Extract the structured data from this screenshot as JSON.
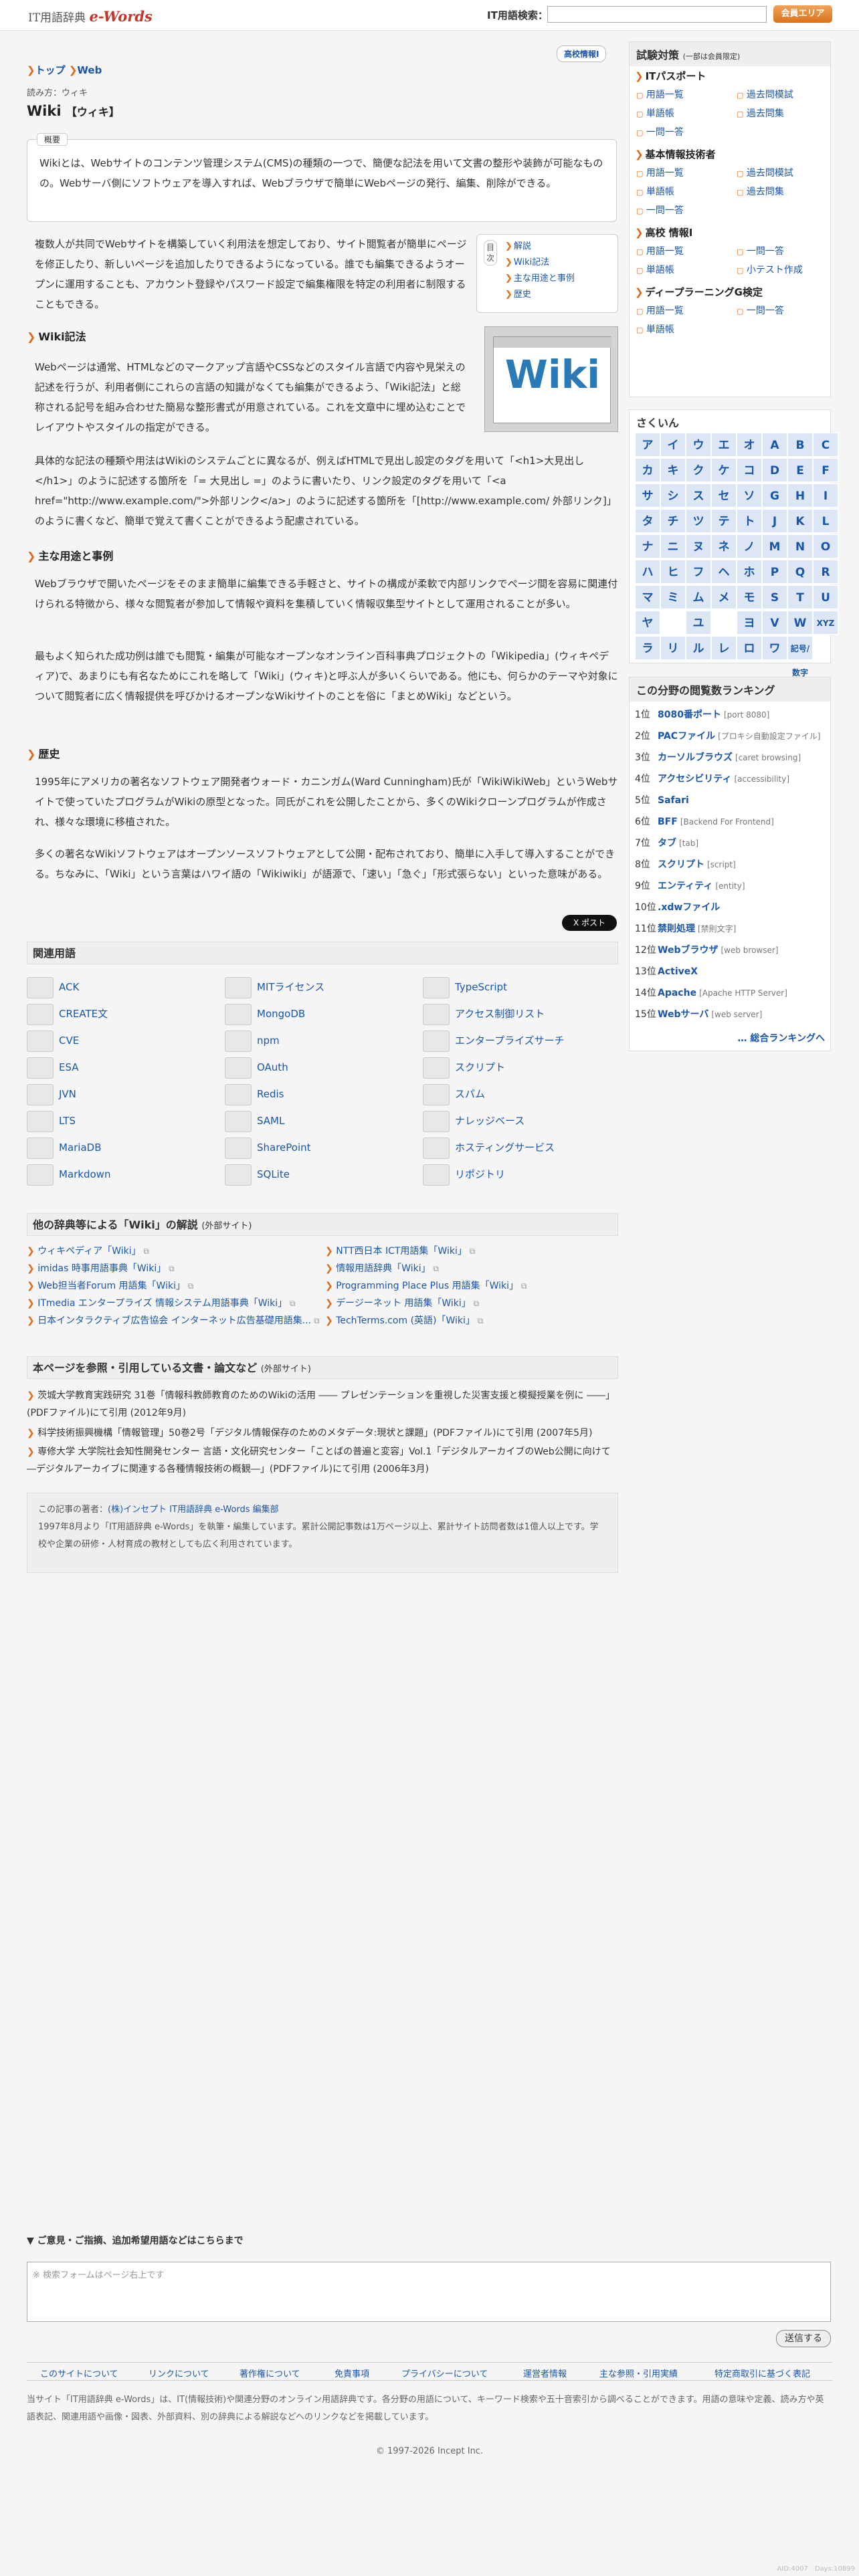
{
  "header": {
    "logo_prefix": "IT用語辞典",
    "logo_brand": "e-Words",
    "search_label": "IT用語検索：",
    "search_placeholder": "",
    "members_button": "会員エリア"
  },
  "article": {
    "highschool_pill": "高校情報Ⅰ",
    "breadcrumb": [
      "トップ",
      "Web"
    ],
    "yomi": "読み方：ウィキ",
    "title": "Wiki",
    "title_suffix": "【ウィキ】",
    "summary_label": "概要",
    "summary": "Wikiとは、Webサイトのコンテンツ管理システム(CMS)の種類の一つで、簡便な記法を用いて文書の整形や装飾が可能なものの。Webサーバ側にソフトウェアを導入すれば、Webブラウザで簡単にWebページの発行、編集、削除ができる。",
    "p1": "複数人が共同でWebサイトを構築していく利用法を想定しており、サイト閲覧者が簡単にページを修正したり、新しいページを追加したりできるようになっている。誰でも編集できるようオープンに運用することも、アカウント登録やパスワード設定で編集権限を特定の利用者に制限することもできる。",
    "toc_label": "目次",
    "toc": [
      "解説",
      "Wiki記法",
      "主な用途と事例",
      "歴史"
    ],
    "image_text": "Wiki",
    "h_notation": "Wiki記法",
    "p2": "Webページは通常、HTMLなどのマークアップ言語やCSSなどのスタイル言語で内容や見栄えの記述を行うが、利用者側にこれらの言語の知識がなくても編集ができるよう、「Wiki記法」と総称される記号を組み合わせた簡易な整形書式が用意されている。これを文章中に埋め込むことでレイアウトやスタイルの指定ができる。",
    "p3": "具体的な記法の種類や用法はWikiのシステムごとに異なるが、例えばHTMLで見出し設定のタグを用いて「<h1>大見出し</h1>」のように記述する箇所を「= 大見出し =」のように書いたり、リンク設定のタグを用いて「<a href=\"http://www.example.com/\">外部リンク</a>」のように記述する箇所を「[http://www.example.com/ 外部リンク]」のように書くなど、簡単で覚えて書くことができるよう配慮されている。",
    "h_usage": "主な用途と事例",
    "p4": "Webブラウザで開いたページをそのまま簡単に編集できる手軽さと、サイトの構成が柔軟で内部リンクでページ間を容易に関連付けられる特徴から、様々な閲覧者が参加して情報や資料を集積していく情報収集型サイトとして運用されることが多い。",
    "p5": "最もよく知られた成功例は誰でも閲覧・編集が可能なオープンなオンライン百科事典プロジェクトの「Wikipedia」(ウィキペディア)で、あまりにも有名なためにこれを略して「Wiki」(ウィキ)と呼ぶ人が多いくらいである。他にも、何らかのテーマや対象について閲覧者に広く情報提供を呼びかけるオープンなWikiサイトのことを俗に「まとめWiki」などという。",
    "h_history": "歴史",
    "p6": "1995年にアメリカの著名なソフトウェア開発者ウォード・カニンガム(Ward Cunningham)氏が「WikiWikiWeb」というWebサイトで使っていたプログラムがWikiの原型となった。同氏がこれを公開したことから、多くのWikiクローンプログラムが作成され、様々な環境に移植された。",
    "p7": "多くの著名なWikiソフトウェアはオープンソースソフトウェアとして公開・配布されており、簡単に入手して導入することができる。ちなみに、「Wiki」という言葉はハワイ語の「Wikiwiki」が語源で、「速い」「急ぐ」「形式張らない」といった意味がある。",
    "tweet": "X ポスト"
  },
  "related": {
    "title": "関連用語",
    "items": [
      "ACK",
      "MITライセンス",
      "TypeScript",
      "CREATE文",
      "MongoDB",
      "アクセス制御リスト",
      "CVE",
      "npm",
      "エンタープライズサーチ",
      "ESA",
      "OAuth",
      "スクリプト",
      "JVN",
      "Redis",
      "スパム",
      "LTS",
      "SAML",
      "ナレッジベース",
      "MariaDB",
      "SharePoint",
      "ホスティングサービス",
      "Markdown",
      "SQLite",
      "リポジトリ"
    ]
  },
  "dictionaries": {
    "title": "他の辞典等による「Wiki」の解説",
    "title_suffix": "(外部サイト)",
    "items": [
      "ウィキペディア「Wiki」",
      "NTT西日本 ICT用語集「Wiki」",
      "imidas 時事用語事典「Wiki」",
      "情報用語辞典「Wiki」",
      "Web担当者Forum 用語集「Wiki」",
      "Programming Place Plus 用語集「Wiki」",
      "ITmedia エンタープライズ 情報システム用語事典「Wiki」",
      "デージーネット 用語集「Wiki」",
      "日本インタラクティブ広告協会 インターネット広告基礎用語集...",
      "TechTerms.com (英語)「Wiki」"
    ]
  },
  "references": {
    "title": "本ページを参照・引用している文書・論文など",
    "title_suffix": "(外部サイト)",
    "items": [
      "茨城大学教育実践研究 31巻「情報科教師教育のためのWikiの活用 ―― プレゼンテーションを重視した災害支援と模擬授業を例に ――」(PDFファイル)にて引用 (2012年9月)",
      "科学技術振興機構「情報管理」50巻2号「デジタル情報保存のためのメタデータ:現状と課題」(PDFファイル)にて引用 (2007年5月)",
      "専修大学 大学院社会知性開発センター 言語・文化研究センター「ことばの普遍と変容」Vol.1「デジタルアーカイブのWeb公開に向けて―デジタルアーカイブに関連する各種情報技術の概観―」(PDFファイル)にて引用 (2006年3月)"
    ]
  },
  "author": {
    "label": "この記事の著者：",
    "name": "(株)インセプト IT用語辞典 e-Words 編集部",
    "desc": "1997年8月より「IT用語辞典 e-Words」を執筆・編集しています。累計公開記事数は1万ページ以上、累計サイト訪問者数は1億人以上です。学校や企業の研修・人材育成の教材としても広く利用されています。"
  },
  "sidebar": {
    "exam_title": "試験対策",
    "exam_note": "(一部は会員限定)",
    "exams": [
      {
        "name": "ITパスポート",
        "links": [
          "用語一覧",
          "過去問模試",
          "単語帳",
          "過去問集",
          "一問一答"
        ]
      },
      {
        "name": "基本情報技術者",
        "links": [
          "用語一覧",
          "過去問模試",
          "単語帳",
          "過去問集",
          "一問一答"
        ]
      },
      {
        "name": "高校 情報Ⅰ",
        "links": [
          "用語一覧",
          "一問一答",
          "単語帳",
          "小テスト作成"
        ]
      },
      {
        "name": "ディープラーニングG検定",
        "links": [
          "用語一覧",
          "一問一答",
          "単語帳"
        ]
      }
    ],
    "sakuin_title": "さくいん",
    "kana": [
      "ア",
      "イ",
      "ウ",
      "エ",
      "オ",
      "A",
      "B",
      "C",
      "カ",
      "キ",
      "ク",
      "ケ",
      "コ",
      "D",
      "E",
      "F",
      "サ",
      "シ",
      "ス",
      "セ",
      "ソ",
      "G",
      "H",
      "I",
      "タ",
      "チ",
      "ツ",
      "テ",
      "ト",
      "J",
      "K",
      "L",
      "ナ",
      "ニ",
      "ヌ",
      "ネ",
      "ノ",
      "M",
      "N",
      "O",
      "ハ",
      "ヒ",
      "フ",
      "ヘ",
      "ホ",
      "P",
      "Q",
      "R",
      "マ",
      "ミ",
      "ム",
      "メ",
      "モ",
      "S",
      "T",
      "U",
      "ヤ",
      "",
      "ユ",
      "",
      "ヨ",
      "V",
      "W",
      "XYZ",
      "ラ",
      "リ",
      "ル",
      "レ",
      "ロ",
      "ワ",
      "記号/数字",
      ""
    ],
    "rank_title": "この分野の閲覧数ランキング",
    "ranks": [
      [
        "1位",
        "8080番ポート",
        "[port 8080]"
      ],
      [
        "2位",
        "PACファイル",
        "[プロキシ自動設定ファイル]"
      ],
      [
        "3位",
        "カーソルブラウズ",
        "[caret browsing]"
      ],
      [
        "4位",
        "アクセシビリティ",
        "[accessibility]"
      ],
      [
        "5位",
        "Safari",
        ""
      ],
      [
        "6位",
        "BFF",
        "[Backend For Frontend]"
      ],
      [
        "7位",
        "タブ",
        "[tab]"
      ],
      [
        "8位",
        "スクリプト",
        "[script]"
      ],
      [
        "9位",
        "エンティティ",
        "[entity]"
      ],
      [
        "10位",
        ".xdwファイル",
        ""
      ],
      [
        "11位",
        "禁則処理",
        "[禁則文字]"
      ],
      [
        "12位",
        "Webブラウザ",
        "[web browser]"
      ],
      [
        "13位",
        "ActiveX",
        ""
      ],
      [
        "14位",
        "Apache",
        "[Apache HTTP Server]"
      ],
      [
        "15位",
        "Webサーバ",
        "[web server]"
      ]
    ],
    "rank_more": "… 総合ランキングへ"
  },
  "feedback": {
    "title": "▼ ご意見・ご指摘、追加希望用語などはこちらまで",
    "placeholder": "※ 検索フォームはページ右上です",
    "submit": "送信する"
  },
  "footer": {
    "links": [
      "このサイトについて",
      "リンクについて",
      "著作権について",
      "免責事項",
      "プライバシーについて",
      "運営者情報",
      "主な参照・引用実績",
      "特定商取引に基づく表記"
    ],
    "text": "当サイト「IT用語辞典 e-Words」は、IT(情報技術)や関連分野のオンライン用語辞典です。各分野の用語について、キーワード検索や五十音索引から調べることができます。用語の意味や定義、読み方や英語表記、関連用語や画像・図表、外部資料、別の辞典による解説などへのリンクなどを掲載しています。",
    "copyright": "© 1997-2026 Incept Inc.",
    "version": "AID:4007　Days:10899"
  }
}
